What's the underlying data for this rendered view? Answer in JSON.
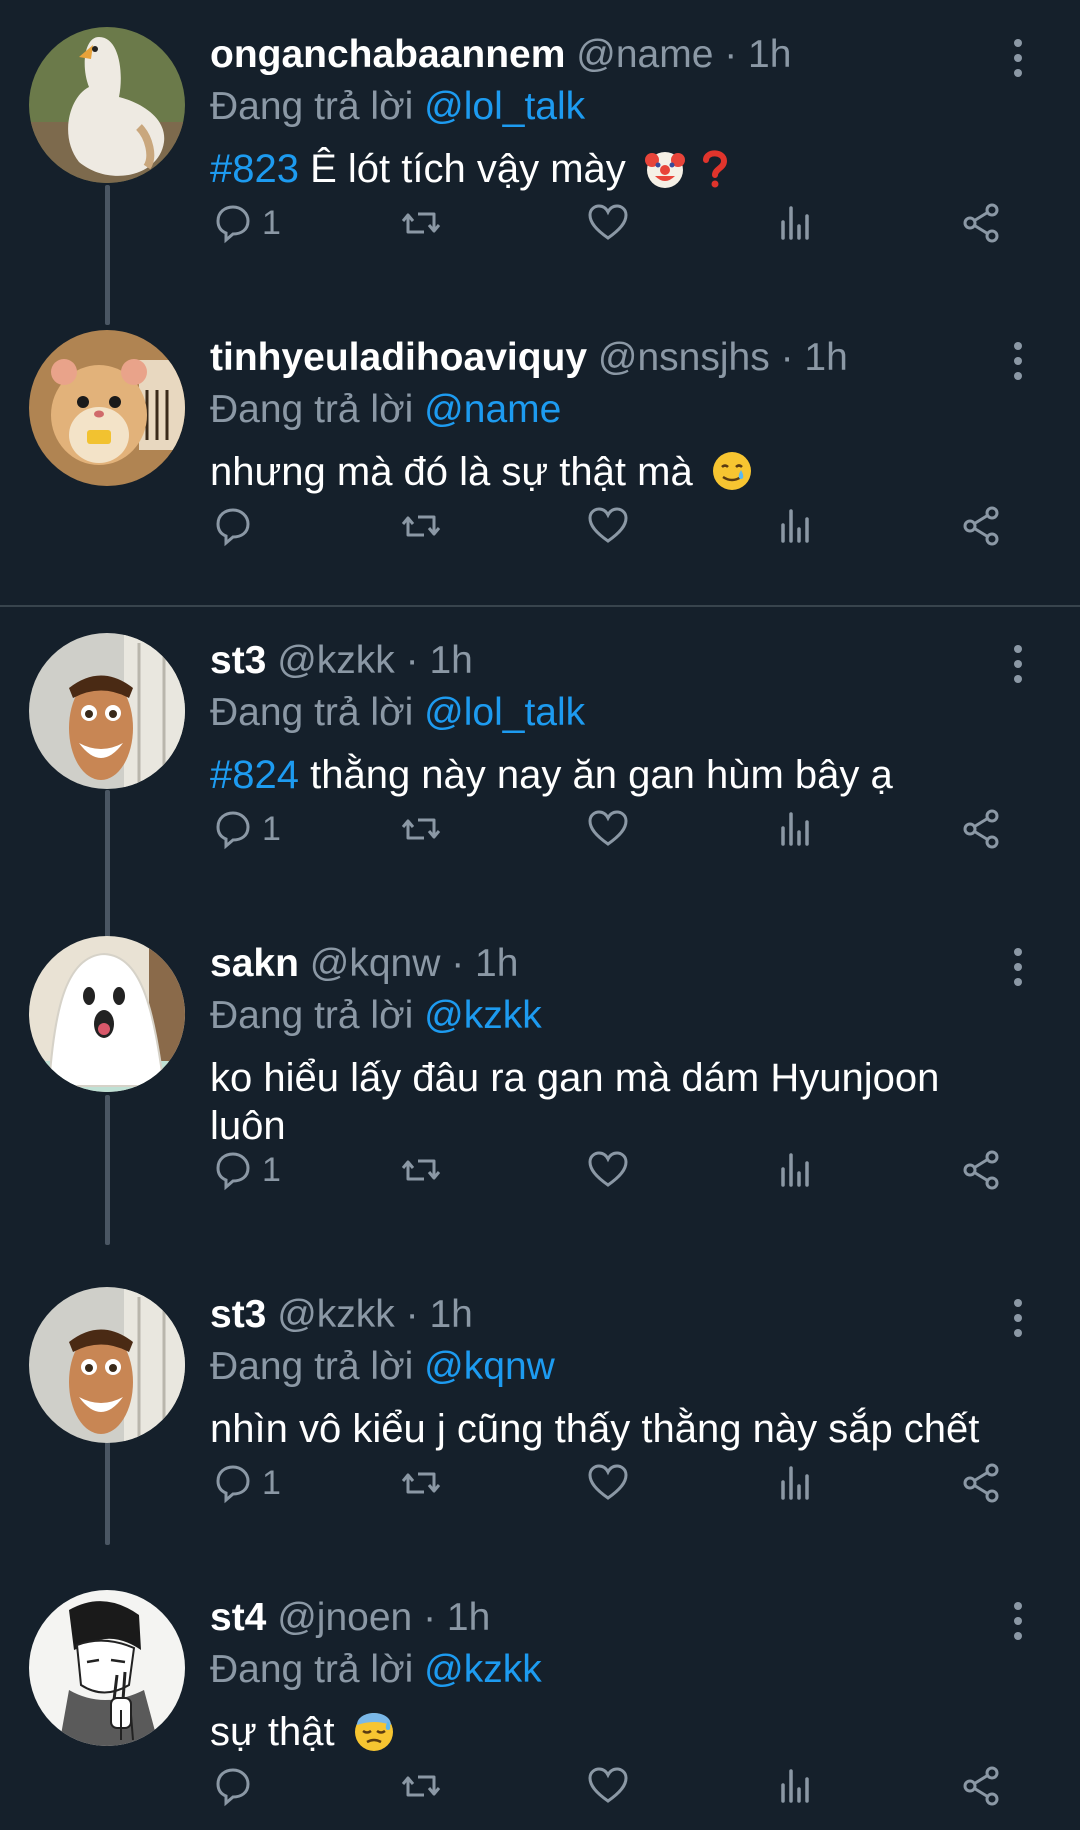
{
  "tweets": [
    {
      "name": "onganchabaannem",
      "handle": "@name · 1h",
      "reply_prefix": "Đang trả lời ",
      "reply_to": "@lol_talk",
      "hashtag": "#823",
      "text": " Ê lót tích vậy mày",
      "emoji": [
        "clown-face-emoji",
        "red-question-mark-emoji"
      ],
      "reply_count": "1",
      "avatar": "goose-avatar"
    },
    {
      "name": "tinhyeuladihoaviquy",
      "handle": "@nsnsjhs · 1h",
      "reply_prefix": "Đang trả lời ",
      "reply_to": "@name",
      "hashtag": "",
      "text": "nhưng mà đó là sự thật mà",
      "emoji": [
        "smiling-face-with-tear-emoji"
      ],
      "reply_count": "",
      "avatar": "hamster-avatar"
    },
    {
      "name": "st3",
      "handle": "@kzkk · 1h",
      "reply_prefix": "Đang trả lời ",
      "reply_to": "@lol_talk",
      "hashtag": "#824",
      "text": " thằng này nay ăn gan hùm bây ạ",
      "emoji": [],
      "reply_count": "1",
      "avatar": "woody-avatar"
    },
    {
      "name": "sakn",
      "handle": "@kqnw · 1h",
      "reply_prefix": "Đang trả lời ",
      "reply_to": "@kzkk",
      "hashtag": "",
      "text": "ko hiểu lấy đâu ra gan mà dám Hyunjoon luôn",
      "emoji": [],
      "reply_count": "1",
      "avatar": "ghost-avatar"
    },
    {
      "name": "st3",
      "handle": "@kzkk · 1h",
      "reply_prefix": "Đang trả lời ",
      "reply_to": "@kqnw",
      "hashtag": "",
      "text": "nhìn vô kiểu j cũng thấy thằng này sắp chết",
      "emoji": [],
      "reply_count": "1",
      "avatar": "woody-avatar"
    },
    {
      "name": "st4",
      "handle": "@jnoen · 1h",
      "reply_prefix": "Đang trả lời ",
      "reply_to": "@kzkk",
      "hashtag": "",
      "text": "sự thật",
      "emoji": [
        "downcast-face-with-sweat-emoji"
      ],
      "reply_count": "",
      "avatar": "manga-avatar"
    }
  ],
  "colors": {
    "background": "#15202b",
    "text": "#ffffff",
    "muted": "#8b98a5",
    "accent": "#1d9bf0",
    "thread_line": "#4a5663",
    "divider": "#38444d"
  },
  "icons": {
    "reply": "reply-icon",
    "retweet": "retweet-icon",
    "like": "heart-icon",
    "views": "views-icon",
    "share": "share-icon",
    "more": "more-vertical-icon"
  }
}
